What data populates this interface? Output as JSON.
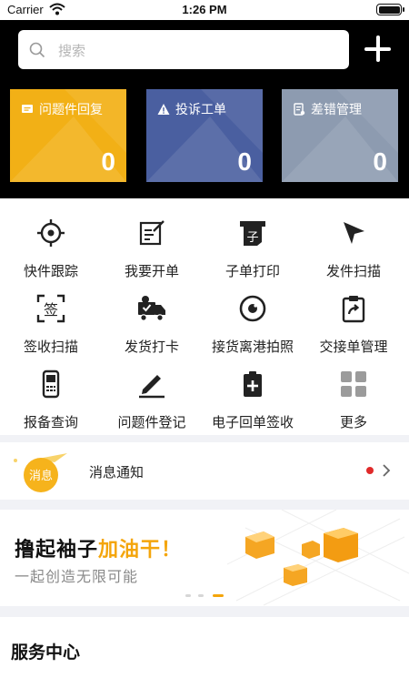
{
  "status": {
    "carrier": "Carrier",
    "time": "1:26 PM"
  },
  "search": {
    "placeholder": "搜索"
  },
  "cards": [
    {
      "title": "问题件回复",
      "count": "0",
      "icon": "message-icon",
      "color": "#f2b016"
    },
    {
      "title": "投诉工单",
      "count": "0",
      "icon": "warning-icon",
      "color": "#4a5fa0"
    },
    {
      "title": "差错管理",
      "count": "0",
      "icon": "document-icon",
      "color": "#8d9bb0"
    }
  ],
  "menu": [
    {
      "label": "快件跟踪",
      "icon": "target-icon"
    },
    {
      "label": "我要开单",
      "icon": "edit-icon"
    },
    {
      "label": "子单打印",
      "icon": "printer-icon"
    },
    {
      "label": "发件扫描",
      "icon": "send-icon"
    },
    {
      "label": "签收扫描",
      "icon": "scan-sign-icon"
    },
    {
      "label": "发货打卡",
      "icon": "truck-icon"
    },
    {
      "label": "接货离港拍照",
      "icon": "camera-icon"
    },
    {
      "label": "交接单管理",
      "icon": "clipboard-icon"
    },
    {
      "label": "报备查询",
      "icon": "handheld-icon"
    },
    {
      "label": "问题件登记",
      "icon": "pen-icon"
    },
    {
      "label": "电子回单签收",
      "icon": "receipt-icon"
    },
    {
      "label": "更多",
      "icon": "grid-icon"
    }
  ],
  "notice": {
    "badge": "消息",
    "text": "消息通知",
    "indicator_color": "#e02a2a"
  },
  "banner": {
    "line1_a": "撸起袖子",
    "line1_b": "加油干！",
    "line2": "一起创造无限可能",
    "accent": "#f4a50b",
    "slides": 3,
    "active_slide": 3
  },
  "service": {
    "title": "服务中心"
  }
}
